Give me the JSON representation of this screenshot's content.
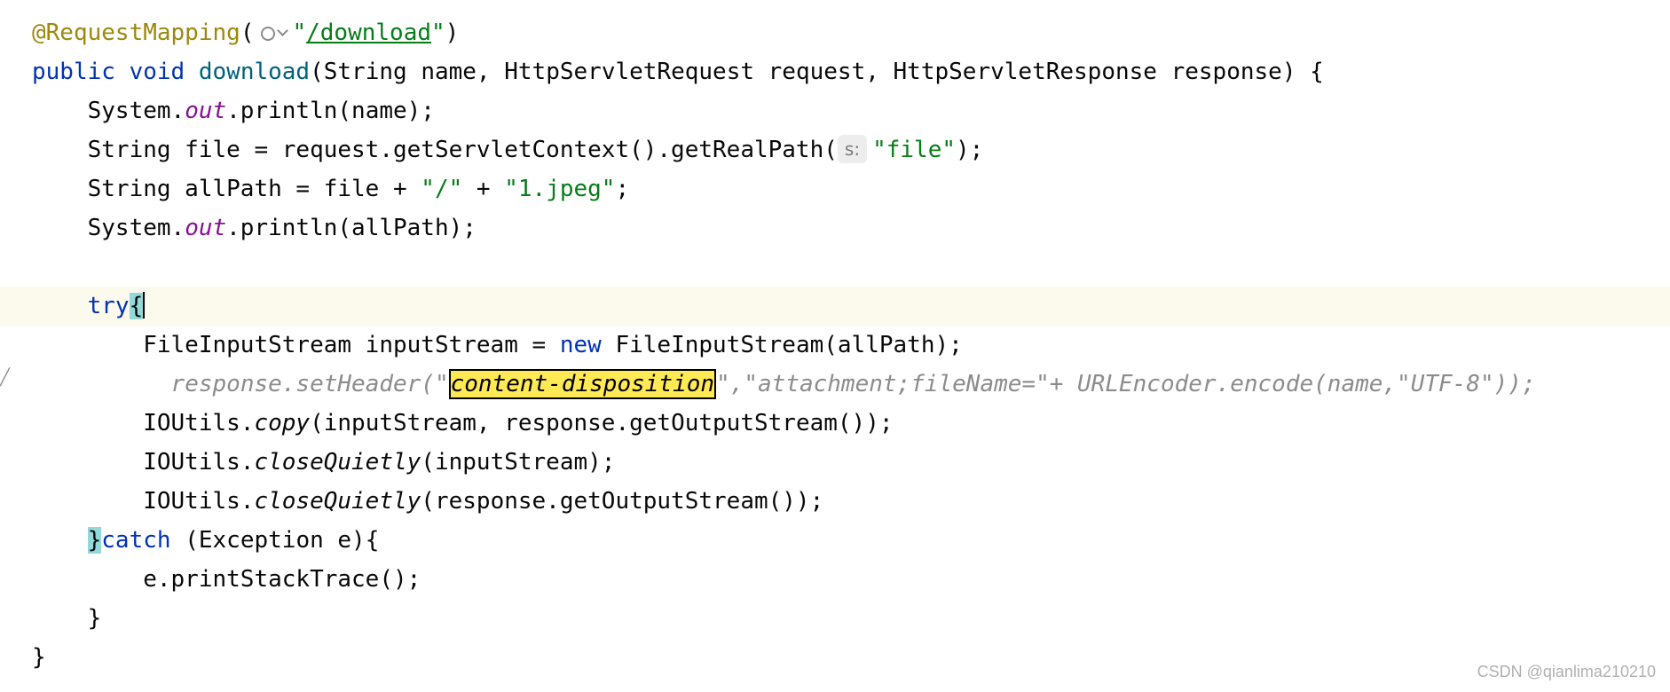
{
  "editor": {
    "l1": {
      "ann": "@RequestMapping",
      "open": "(",
      "q1": "\"",
      "url": "/download",
      "q2": "\"",
      "close": ")"
    },
    "l2": {
      "kw1": "public",
      "sp1": " ",
      "kw2": "void",
      "sp2": " ",
      "fn": "download",
      "rest": "(String name, HttpServletRequest request, HttpServletResponse response) {"
    },
    "l3": {
      "pre": "    System.",
      "field": "out",
      "post": ".println(name);"
    },
    "l4": {
      "pre": "    String file = request.getServletContext().getRealPath(",
      "hint": "s:",
      "str": "\"file\"",
      "post": ");"
    },
    "l5": {
      "pre": "    String allPath = file + ",
      "str1": "\"/\"",
      "mid": " + ",
      "str2": "\"1.jpeg\"",
      "post": ";"
    },
    "l6": {
      "pre": "    System.",
      "field": "out",
      "post": ".println(allPath);"
    },
    "l8": {
      "indent": "    ",
      "kw": "try",
      "brace": "{"
    },
    "l9": {
      "pre": "        FileInputStream inputStream = ",
      "kw": "new",
      "post": " FileInputStream(allPath);"
    },
    "l10": {
      "indent": "          ",
      "pre": "response.setHeader(\"",
      "hit": "content-disposition",
      "post": "\",\"attachment;fileName=\"+ URLEncoder.encode(name,\"UTF-8\"));"
    },
    "l11": {
      "pre": "        IOUtils.",
      "method": "copy",
      "post": "(inputStream, response.getOutputStream());"
    },
    "l12": {
      "pre": "        IOUtils.",
      "method": "closeQuietly",
      "post": "(inputStream);"
    },
    "l13": {
      "pre": "        IOUtils.",
      "method": "closeQuietly",
      "post": "(response.getOutputStream());"
    },
    "l14": {
      "indent": "    ",
      "brace": "}",
      "kw": "catch",
      "post": " (Exception e){"
    },
    "l15": {
      "text": "        e.printStackTrace();"
    },
    "l16": {
      "text": "    }"
    },
    "l17": {
      "text": "}"
    }
  },
  "gutter_mark": "╱",
  "watermark": "CSDN @qianlima210210",
  "icons": [
    "globe-icon",
    "chevron-down-icon"
  ],
  "colors": {
    "keyword": "#0033b3",
    "function": "#00627a",
    "string": "#067d17",
    "annotation": "#9e880d",
    "field": "#871094",
    "comment_ghost": "#8c8c8c",
    "search_highlight": "#ffe955",
    "brace_match": "#93d9d9",
    "current_line": "#fcfaed"
  }
}
